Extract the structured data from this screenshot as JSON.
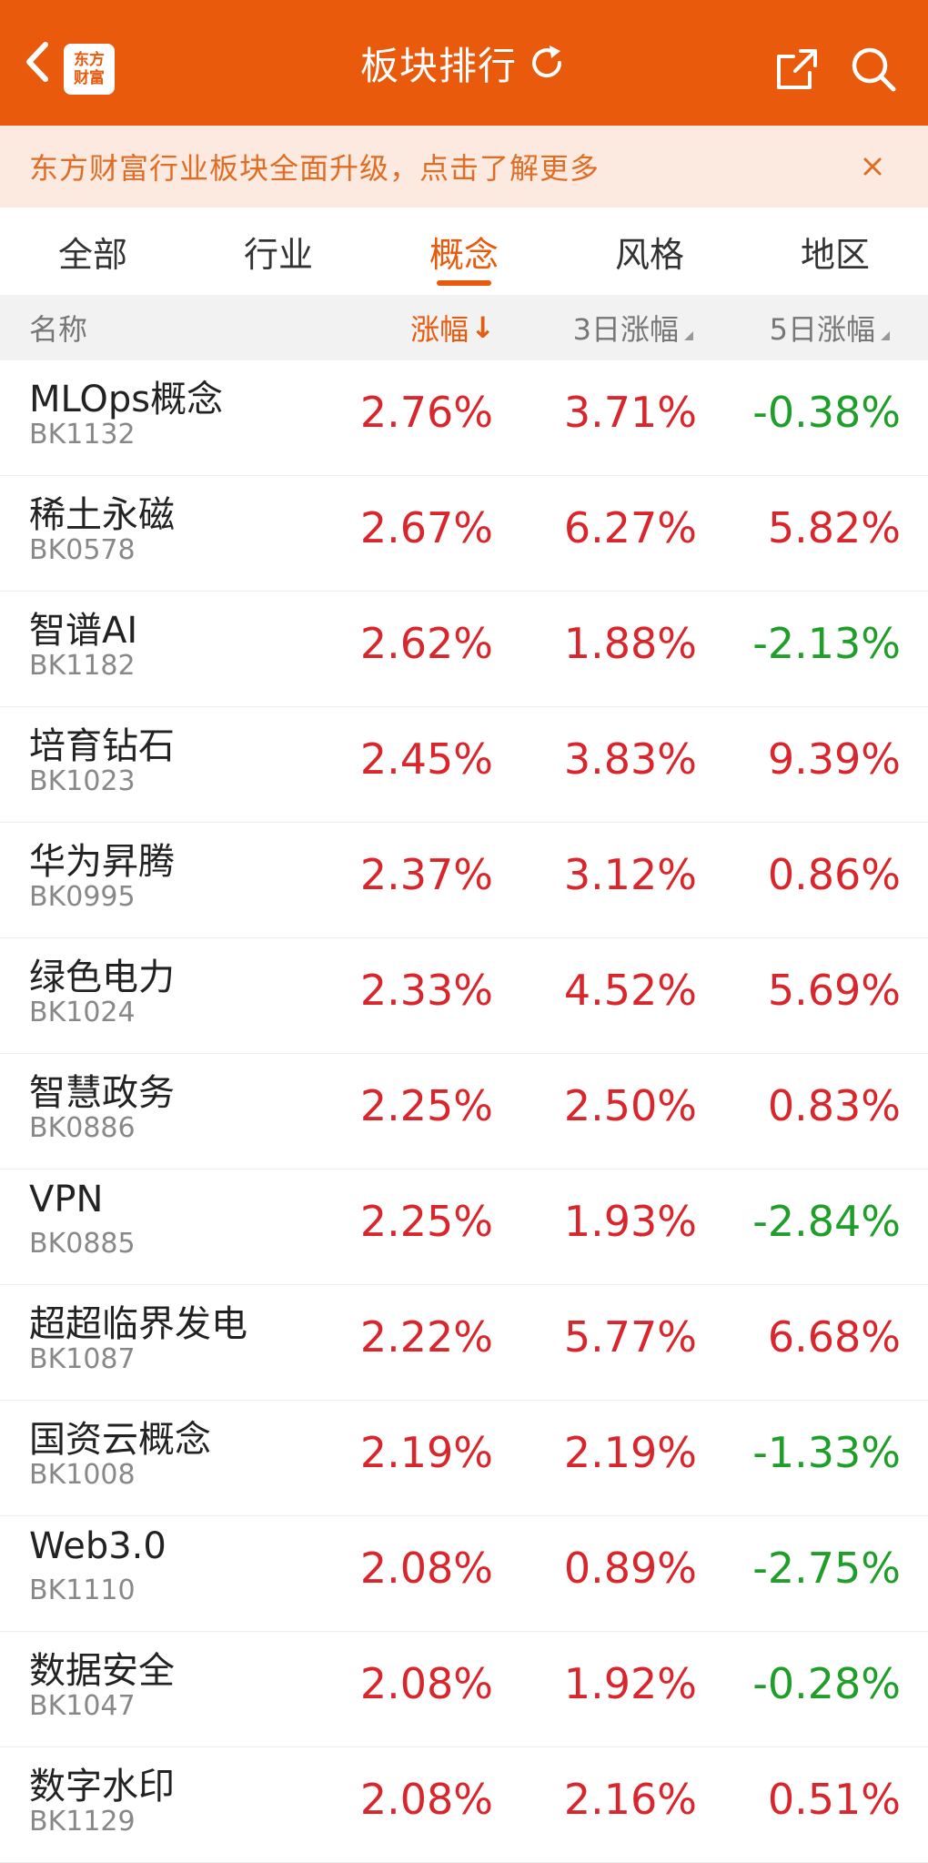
{
  "header": {
    "title": "板块排行",
    "logo_line1": "东方",
    "logo_line2": "财富",
    "back_icon": "chevron-left-icon",
    "refresh_icon": "refresh-icon",
    "share_icon": "share-icon",
    "search_icon": "search-icon",
    "background_color": "#e95a0c"
  },
  "banner": {
    "text": "东方财富行业板块全面升级，点击了解更多",
    "close_icon": "close-icon"
  },
  "tabs": [
    {
      "label": "全部"
    },
    {
      "label": "行业"
    },
    {
      "label": "概念"
    },
    {
      "label": "风格"
    },
    {
      "label": "地区"
    }
  ],
  "active_tab": "概念",
  "columns": {
    "name": "名称",
    "change": "涨幅",
    "change_arrow": "↓",
    "change_3d": "3日涨幅",
    "change_5d": "5日涨幅"
  },
  "colors": {
    "accent": "#e95a0c",
    "up": "#d9262c",
    "down": "#1f9e2a"
  },
  "rows": [
    {
      "name": "MLOps概念",
      "code": "BK1132",
      "change": "2.76%",
      "change_3d": "3.71%",
      "change_5d": "-0.38%"
    },
    {
      "name": "稀土永磁",
      "code": "BK0578",
      "change": "2.67%",
      "change_3d": "6.27%",
      "change_5d": "5.82%"
    },
    {
      "name": "智谱AI",
      "code": "BK1182",
      "change": "2.62%",
      "change_3d": "1.88%",
      "change_5d": "-2.13%"
    },
    {
      "name": "培育钻石",
      "code": "BK1023",
      "change": "2.45%",
      "change_3d": "3.83%",
      "change_5d": "9.39%"
    },
    {
      "name": "华为昇腾",
      "code": "BK0995",
      "change": "2.37%",
      "change_3d": "3.12%",
      "change_5d": "0.86%"
    },
    {
      "name": "绿色电力",
      "code": "BK1024",
      "change": "2.33%",
      "change_3d": "4.52%",
      "change_5d": "5.69%"
    },
    {
      "name": "智慧政务",
      "code": "BK0886",
      "change": "2.25%",
      "change_3d": "2.50%",
      "change_5d": "0.83%"
    },
    {
      "name": "VPN",
      "code": "BK0885",
      "change": "2.25%",
      "change_3d": "1.93%",
      "change_5d": "-2.84%"
    },
    {
      "name": "超超临界发电",
      "code": "BK1087",
      "change": "2.22%",
      "change_3d": "5.77%",
      "change_5d": "6.68%"
    },
    {
      "name": "国资云概念",
      "code": "BK1008",
      "change": "2.19%",
      "change_3d": "2.19%",
      "change_5d": "-1.33%"
    },
    {
      "name": "Web3.0",
      "code": "BK1110",
      "change": "2.08%",
      "change_3d": "0.89%",
      "change_5d": "-2.75%"
    },
    {
      "name": "数据安全",
      "code": "BK1047",
      "change": "2.08%",
      "change_3d": "1.92%",
      "change_5d": "-0.28%"
    },
    {
      "name": "数字水印",
      "code": "BK1129",
      "change": "2.08%",
      "change_3d": "2.16%",
      "change_5d": "0.51%"
    }
  ]
}
